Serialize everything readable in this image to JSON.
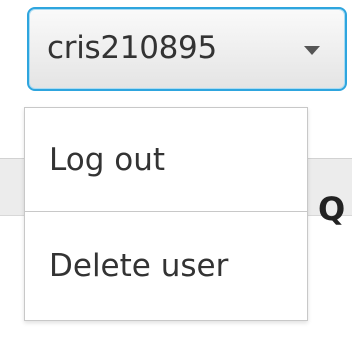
{
  "user_menu": {
    "username": "cris210895",
    "caret_icon": "chevron-down-icon",
    "accent_color": "#2ea5de",
    "items": [
      {
        "label": "Log out"
      },
      {
        "label": "Delete user"
      }
    ]
  },
  "background": {
    "partial_text": "Q"
  }
}
